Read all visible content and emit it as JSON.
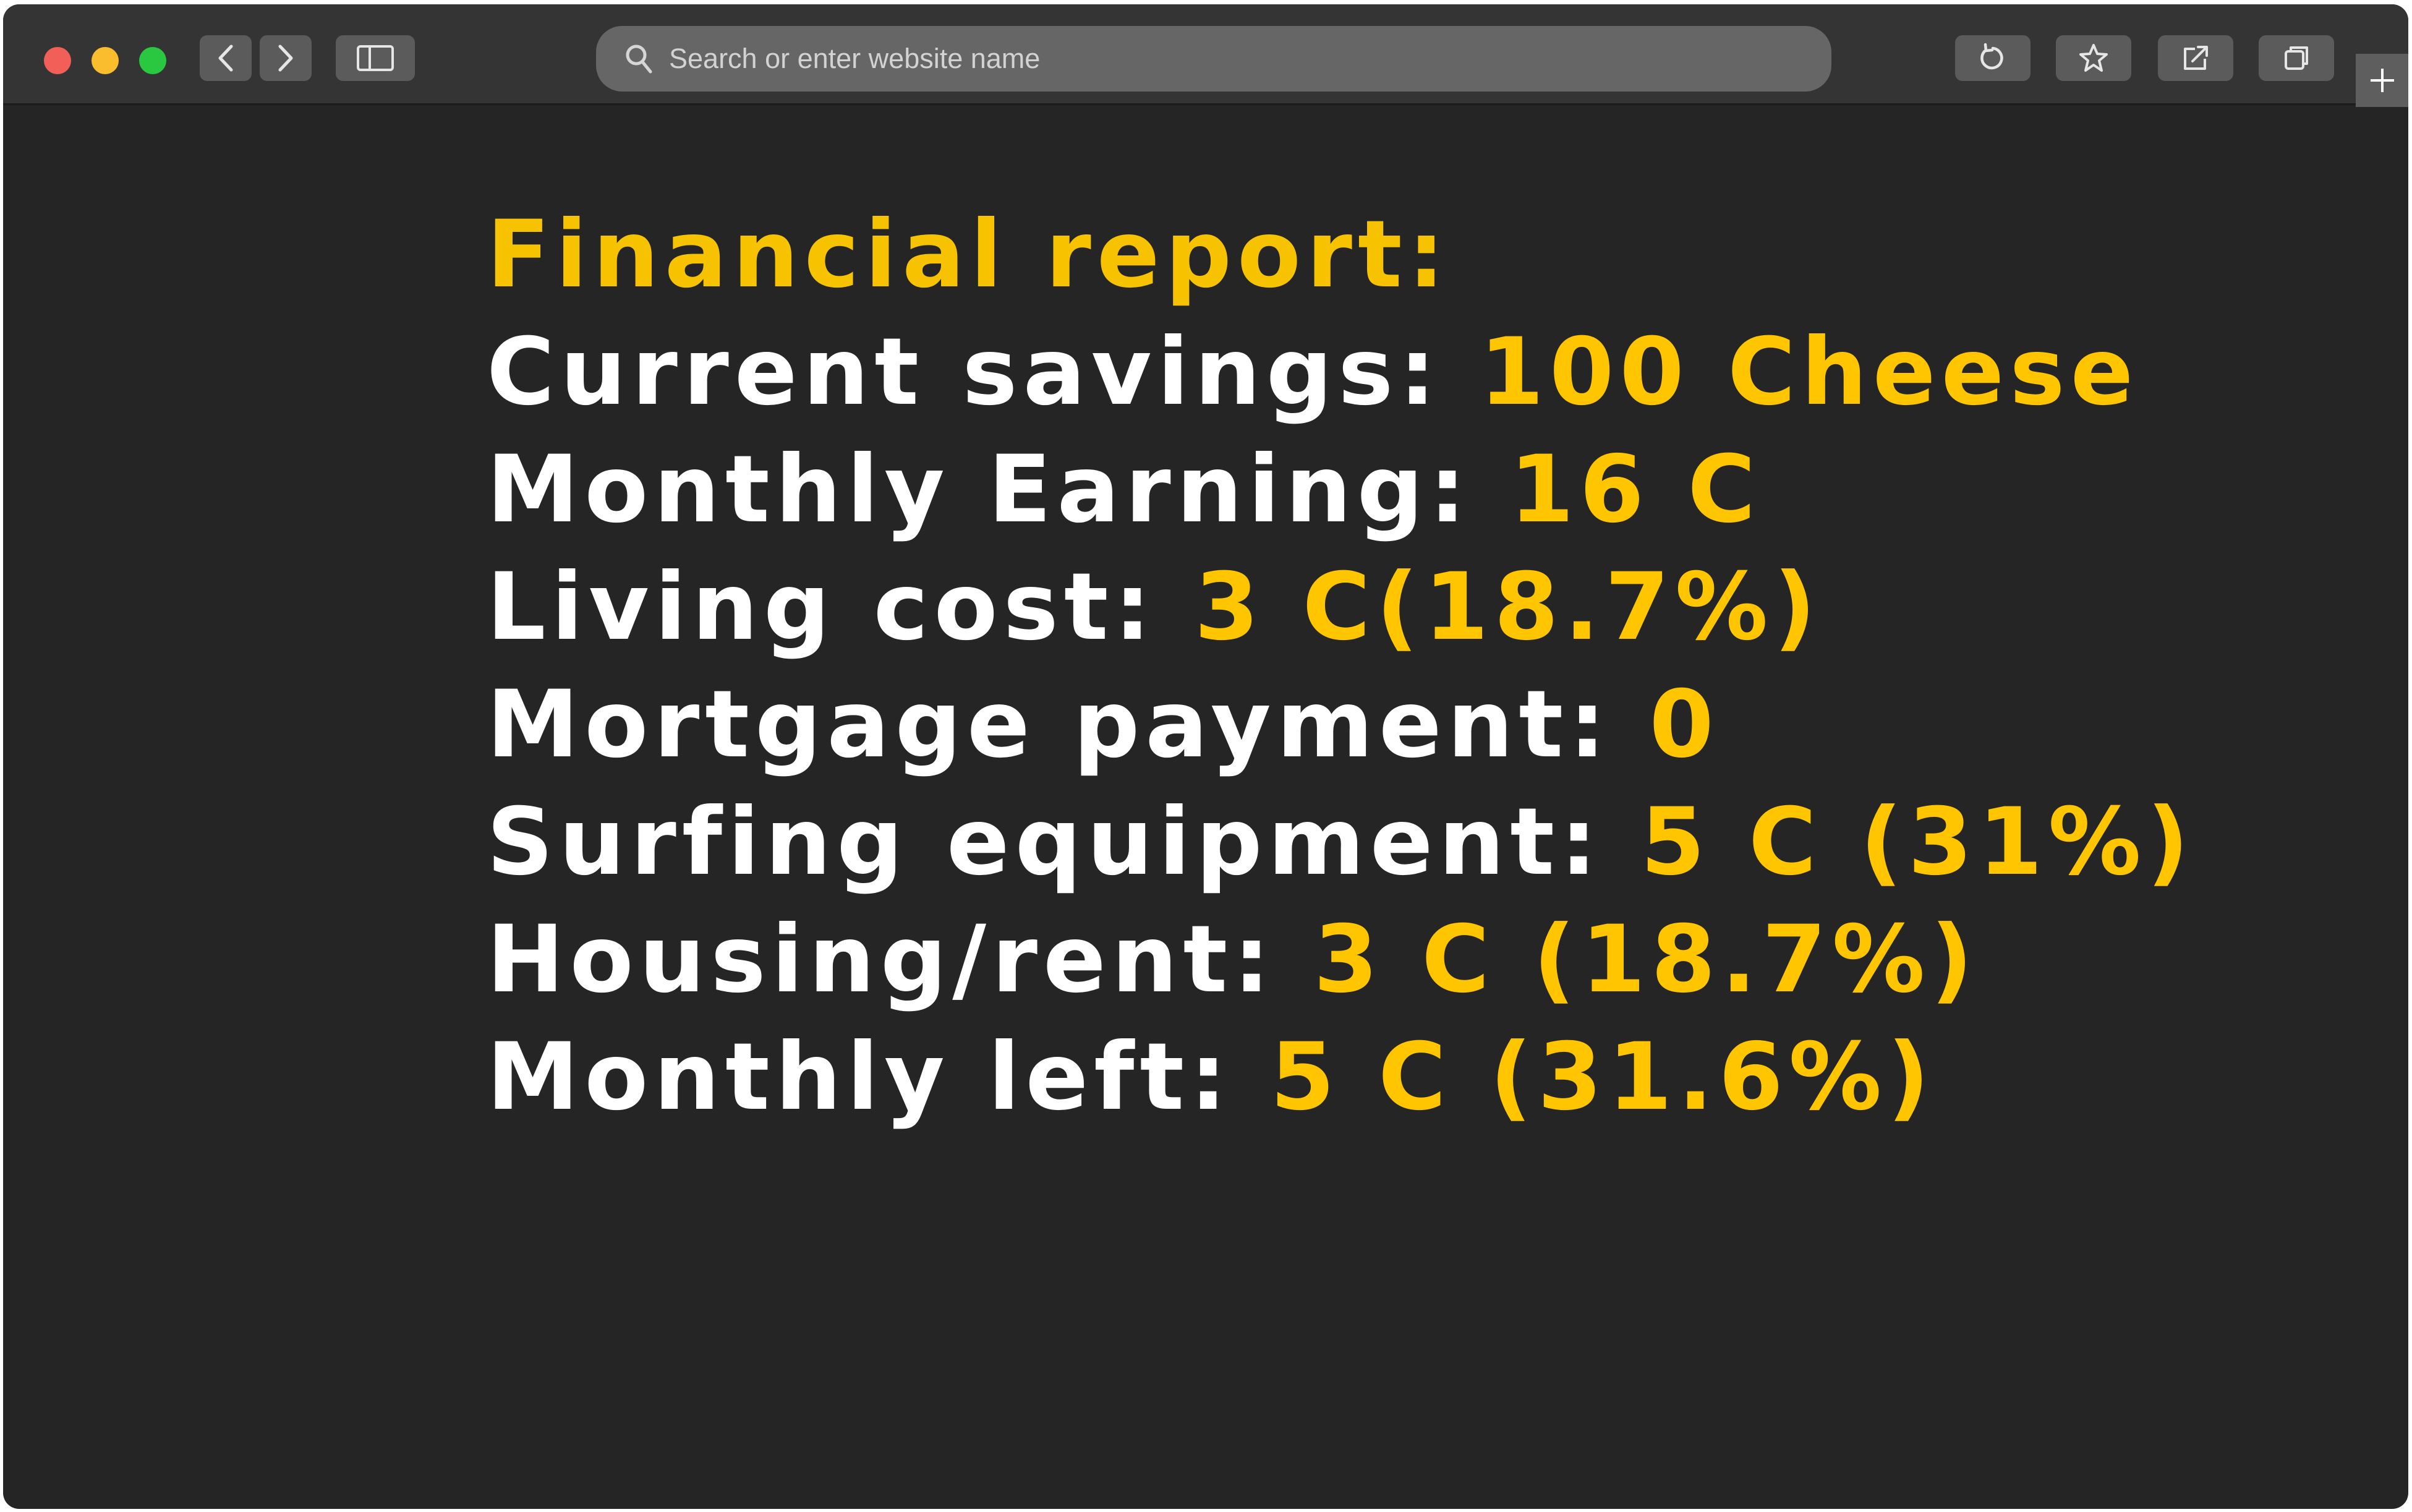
{
  "address_bar": {
    "placeholder": "Search or enter website name"
  },
  "report": {
    "title": "Financial report:",
    "rows": [
      {
        "label": "Current savings:",
        "value": "100 Cheese"
      },
      {
        "label": "Monthly Earning:",
        "value": "16 C"
      },
      {
        "label": "Living cost:",
        "value": "3 C(18.7%)"
      },
      {
        "label": "Mortgage payment:",
        "value": "0"
      },
      {
        "label": "Surfing equipment:",
        "value": "5 C (31%)"
      },
      {
        "label": "Housing/rent:",
        "value": "3 C (18.7%)"
      },
      {
        "label": "Monthly left:",
        "value": "5 C (31.6%)"
      }
    ]
  },
  "colors": {
    "window_background": "#252525",
    "toolbar": "#343434",
    "accent_yellow": "#ffc600",
    "text_white": "#ffffff",
    "close": "#f25f58",
    "minimize": "#f9bd2e",
    "maximize": "#2ac840"
  },
  "icons": [
    "chevron-left-icon",
    "chevron-right-icon",
    "sidebar-icon",
    "search-icon",
    "reload-icon",
    "star-icon",
    "share-icon",
    "tabs-icon",
    "plus-icon"
  ]
}
